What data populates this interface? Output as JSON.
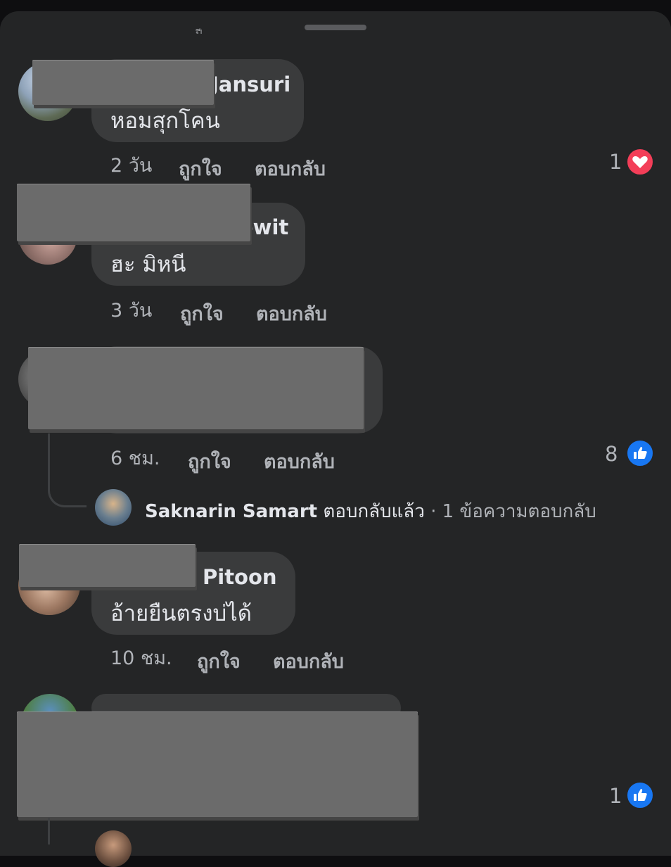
{
  "comments": [
    {
      "name_partial": "Jansuri",
      "text": "หอมสุกโคน",
      "time": "2 วัน",
      "like_label": "ถูกใจ",
      "reply_label": "ตอบกลับ",
      "reaction": {
        "count": "1",
        "type": "heart-icon",
        "color": "#f33e58"
      }
    },
    {
      "name_partial": "ewit",
      "text": "ฮะ มิหนี",
      "time": "3 วัน",
      "like_label": "ถูกใจ",
      "reply_label": "ตอบกลับ"
    },
    {
      "time": "6 ชม.",
      "like_label": "ถูกใจ",
      "reply_label": "ตอบกลับ",
      "reaction": {
        "count": "8",
        "type": "like-icon",
        "color": "#1877f2"
      },
      "reply_summary": {
        "name": "Saknarin Samart",
        "action": "ตอบกลับแล้ว",
        "separator": "·",
        "count": "1 ข้อความตอบกลับ"
      }
    },
    {
      "name_partial": "Pitoon",
      "text": "อ้ายยืนตรงบ่ได้",
      "time": "10 ชม.",
      "like_label": "ถูกใจ",
      "reply_label": "ตอบกลับ"
    },
    {
      "reaction": {
        "count": "1",
        "type": "like-icon",
        "color": "#1877f2"
      }
    }
  ],
  "colors": {
    "sheet_bg": "#242526",
    "bubble_bg": "#3a3b3c",
    "redaction": "#6b6b6b"
  }
}
